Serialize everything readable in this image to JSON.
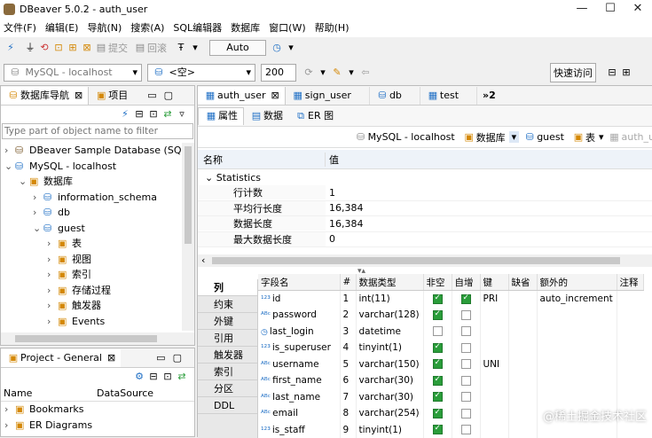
{
  "window": {
    "title": "DBeaver 5.0.2 - auth_user",
    "min": "—",
    "max": "☐",
    "close": "✕"
  },
  "menu": [
    "文件(F)",
    "编辑(E)",
    "导航(N)",
    "搜索(A)",
    "SQL编辑器",
    "数据库",
    "窗口(W)",
    "帮助(H)"
  ],
  "toolbar1": {
    "tx_submit": "提交",
    "tx_rollback": "回滚",
    "mode": "Auto"
  },
  "toolbar2": {
    "connection": "MySQL - localhost",
    "schema": "<空>",
    "limit": "200",
    "quick_access": "快速访问"
  },
  "nav": {
    "tab_nav": "数据库导航",
    "tab_project": "项目",
    "filter_placeholder": "Type part of object name to filter",
    "tree": [
      {
        "indent": 0,
        "arrow": "›",
        "icon": "dbv",
        "label": "DBeaver Sample Database (SQLit"
      },
      {
        "indent": 0,
        "arrow": "⌄",
        "icon": "conn",
        "label": "MySQL - localhost"
      },
      {
        "indent": 1,
        "arrow": "⌄",
        "icon": "folder",
        "label": "数据库"
      },
      {
        "indent": 2,
        "arrow": "›",
        "icon": "db",
        "label": "information_schema"
      },
      {
        "indent": 2,
        "arrow": "›",
        "icon": "db",
        "label": "db"
      },
      {
        "indent": 2,
        "arrow": "⌄",
        "icon": "db",
        "label": "guest"
      },
      {
        "indent": 3,
        "arrow": "›",
        "icon": "folder",
        "label": "表"
      },
      {
        "indent": 3,
        "arrow": "›",
        "icon": "folder",
        "label": "视图"
      },
      {
        "indent": 3,
        "arrow": "›",
        "icon": "folder",
        "label": "索引"
      },
      {
        "indent": 3,
        "arrow": "›",
        "icon": "folder",
        "label": "存储过程"
      },
      {
        "indent": 3,
        "arrow": "›",
        "icon": "folder",
        "label": "触发器"
      },
      {
        "indent": 3,
        "arrow": "›",
        "icon": "folder",
        "label": "Events"
      }
    ]
  },
  "project": {
    "title": "Project - General",
    "col_name": "Name",
    "col_ds": "DataSource",
    "items": [
      {
        "label": "Bookmarks"
      },
      {
        "label": "ER Diagrams"
      }
    ]
  },
  "editor_tabs": [
    {
      "label": "auth_user"
    },
    {
      "label": "sign_user"
    },
    {
      "label": "db"
    },
    {
      "label": "test"
    }
  ],
  "editor_tabs_more": "»2",
  "sub_tabs": {
    "props": "属性",
    "data": "数据",
    "er": "ER 图"
  },
  "breadcrumb": {
    "conn": "MySQL - localhost",
    "db": "数据库",
    "schema": "guest",
    "table": "表",
    "current": "auth_user"
  },
  "props": {
    "col_name": "名称",
    "col_value": "值",
    "group": "Statistics",
    "rows": [
      {
        "k": "行计数",
        "v": "1"
      },
      {
        "k": "平均行长度",
        "v": "16,384"
      },
      {
        "k": "数据长度",
        "v": "16,384"
      },
      {
        "k": "最大数据长度",
        "v": "0"
      }
    ]
  },
  "sidenav": [
    "列",
    "约束",
    "外键",
    "引用",
    "触发器",
    "索引",
    "分区",
    "DDL"
  ],
  "cols": {
    "headers": [
      "字段名",
      "#",
      "数据类型",
      "非空",
      "自增",
      "键",
      "缺省",
      "额外的",
      "注释"
    ],
    "rows": [
      {
        "name": "id",
        "type": "int(11)",
        "idx": "1",
        "nn": true,
        "ai": true,
        "key": "PRI",
        "extra": "auto_increment",
        "kind": "123"
      },
      {
        "name": "password",
        "type": "varchar(128)",
        "idx": "2",
        "nn": true,
        "ai": false,
        "key": "",
        "extra": "",
        "kind": "ABC"
      },
      {
        "name": "last_login",
        "type": "datetime",
        "idx": "3",
        "nn": false,
        "ai": false,
        "key": "",
        "extra": "",
        "kind": "time"
      },
      {
        "name": "is_superuser",
        "type": "tinyint(1)",
        "idx": "4",
        "nn": true,
        "ai": false,
        "key": "",
        "extra": "",
        "kind": "123"
      },
      {
        "name": "username",
        "type": "varchar(150)",
        "idx": "5",
        "nn": true,
        "ai": false,
        "key": "UNI",
        "extra": "",
        "kind": "ABC"
      },
      {
        "name": "first_name",
        "type": "varchar(30)",
        "idx": "6",
        "nn": true,
        "ai": false,
        "key": "",
        "extra": "",
        "kind": "ABC"
      },
      {
        "name": "last_name",
        "type": "varchar(30)",
        "idx": "7",
        "nn": true,
        "ai": false,
        "key": "",
        "extra": "",
        "kind": "ABC"
      },
      {
        "name": "email",
        "type": "varchar(254)",
        "idx": "8",
        "nn": true,
        "ai": false,
        "key": "",
        "extra": "",
        "kind": "ABC"
      },
      {
        "name": "is_staff",
        "type": "tinyint(1)",
        "idx": "9",
        "nn": true,
        "ai": false,
        "key": "",
        "extra": "",
        "kind": "123"
      }
    ]
  },
  "watermark": "@稀土掘金技术社区"
}
